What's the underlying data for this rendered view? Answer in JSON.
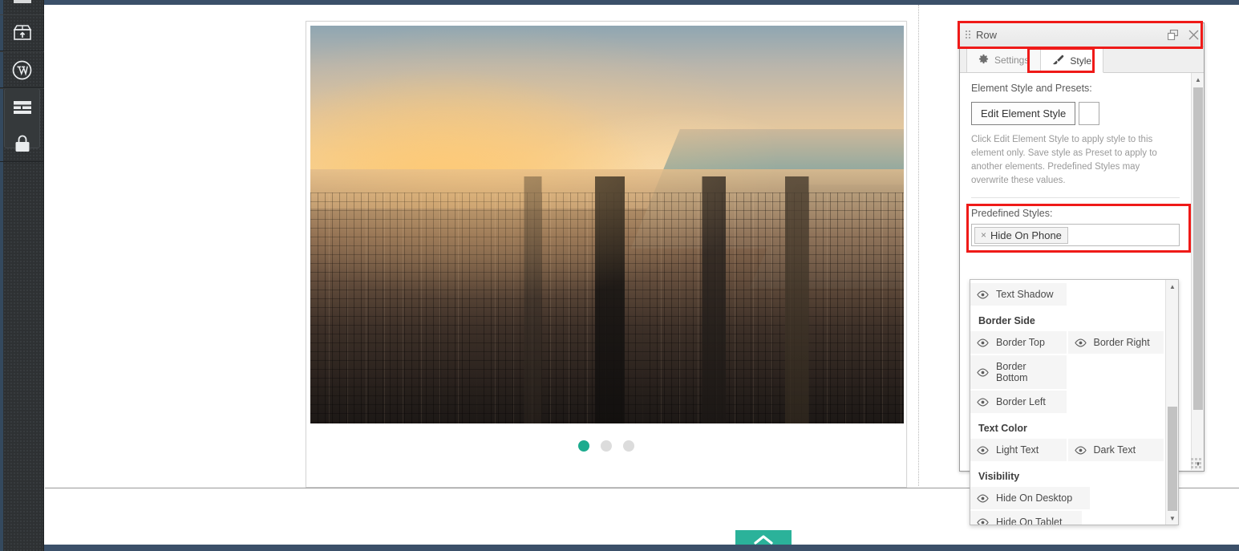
{
  "sidebar": {
    "items": [
      {
        "name": "add-module-icon",
        "label": "Add Module"
      },
      {
        "name": "wordpress-icon",
        "label": "WordPress"
      },
      {
        "name": "rows-layout-icon",
        "label": "Rows"
      },
      {
        "name": "lock-icon",
        "label": "Lock"
      }
    ]
  },
  "canvas": {
    "slider": {
      "image_alt": "Aerial sunset view of Chicago skyline and Lake Michigan",
      "dots": [
        {
          "index": 1,
          "active": true
        },
        {
          "index": 2,
          "active": false
        },
        {
          "index": 3,
          "active": false
        }
      ],
      "active_color": "#1cab8e",
      "inactive_color": "#dcdcdc"
    },
    "back_to_top": {
      "label": "",
      "icon": "chevron-up-icon",
      "color": "#2bb29a"
    }
  },
  "panel": {
    "title": "Row",
    "header_buttons": [
      {
        "name": "restore-icon",
        "label": ""
      },
      {
        "name": "close-icon",
        "label": "×"
      }
    ],
    "tabs": [
      {
        "id": "settings",
        "label": "Settings",
        "icon": "gear-icon",
        "active": false
      },
      {
        "id": "style",
        "label": "Style",
        "icon": "brush-icon",
        "active": true
      }
    ],
    "element_style": {
      "section_label": "Element Style and Presets:",
      "edit_button": "Edit Element Style",
      "help_text": "Click Edit Element Style to apply style to this element only. Save style as Preset to apply to another elements. Predefined Styles may overwrite these values."
    },
    "predefined": {
      "label": "Predefined Styles:",
      "tags": [
        {
          "remove": "×",
          "label": "Hide On Phone"
        }
      ],
      "input_placeholder": ""
    },
    "highlights": {
      "color": "#ef1a18"
    }
  },
  "dropdown": {
    "groups": [
      {
        "title": "",
        "items": [
          {
            "label": "Text Shadow",
            "icon": "eye-icon"
          }
        ]
      },
      {
        "title": "Border Side",
        "items": [
          {
            "label": "Border Top",
            "icon": "eye-icon"
          },
          {
            "label": "Border Right",
            "icon": "eye-icon"
          },
          {
            "label": "Border Bottom",
            "icon": "eye-icon"
          },
          {
            "label": "Border Left",
            "icon": "eye-icon"
          }
        ]
      },
      {
        "title": "Text Color",
        "items": [
          {
            "label": "Light Text",
            "icon": "eye-icon"
          },
          {
            "label": "Dark Text",
            "icon": "eye-icon"
          }
        ]
      },
      {
        "title": "Visibility",
        "items": [
          {
            "label": "Hide On Desktop",
            "icon": "eye-icon"
          },
          {
            "label": "Hide On Tablet",
            "icon": "eye-icon"
          }
        ]
      }
    ]
  }
}
